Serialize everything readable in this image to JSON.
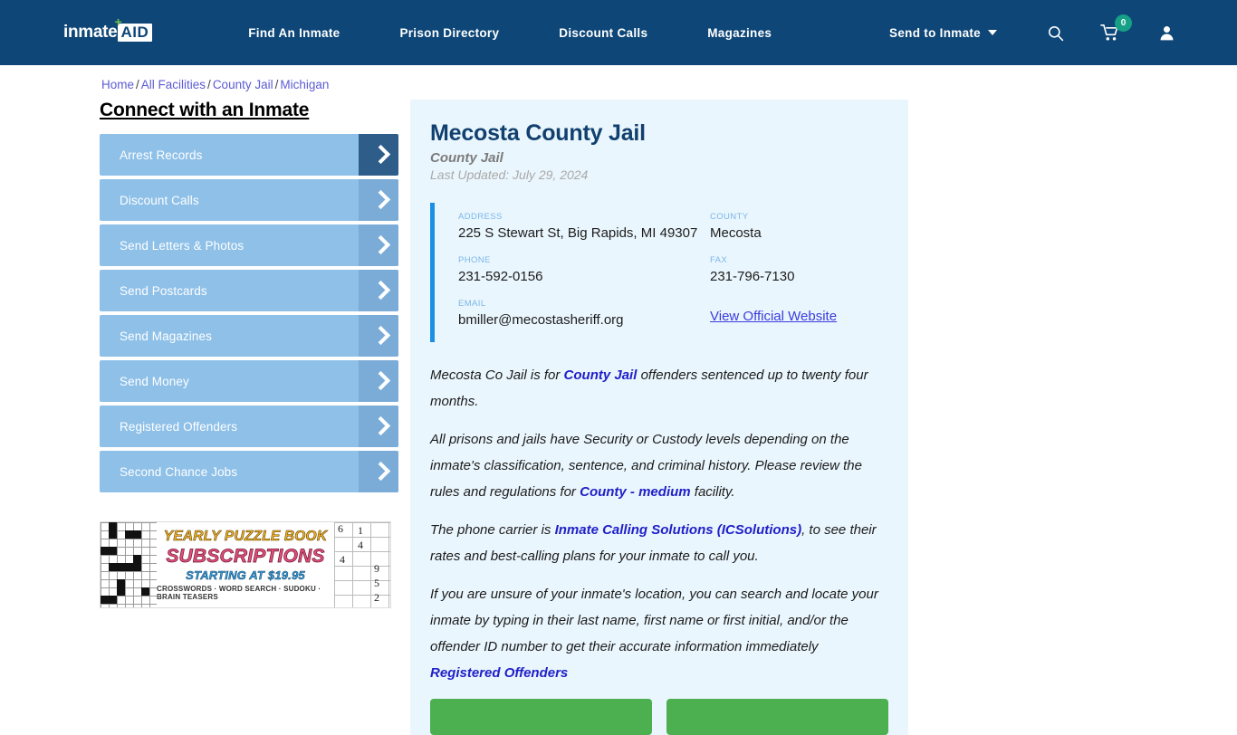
{
  "navbar": {
    "logo": {
      "word": "inmate",
      "badge": "AID",
      "plus": "+"
    },
    "links": [
      {
        "label": "Find An Inmate"
      },
      {
        "label": "Prison Directory"
      },
      {
        "label": "Discount Calls"
      },
      {
        "label": "Magazines"
      }
    ],
    "dropdown": {
      "label": "Send to Inmate"
    },
    "icons": {
      "search": "search-icon",
      "cart": "cart-icon",
      "account": "user-icon"
    },
    "cart_count": "0",
    "bg_color": "#0d4677",
    "badge_color": "#16a085"
  },
  "breadcrumb": {
    "items": [
      "Home",
      "All Facilities",
      "County Jail",
      "Michigan"
    ],
    "separator": "/"
  },
  "sidebar": {
    "title": "Connect with an Inmate",
    "items": [
      {
        "label": "Arrest Records",
        "active": true
      },
      {
        "label": "Discount Calls",
        "active": false
      },
      {
        "label": "Send Letters & Photos",
        "active": false
      },
      {
        "label": "Send Postcards",
        "active": false
      },
      {
        "label": "Send Magazines",
        "active": false
      },
      {
        "label": "Send Money",
        "active": false
      },
      {
        "label": "Registered Offenders",
        "active": false
      },
      {
        "label": "Second Chance Jobs",
        "active": false
      }
    ],
    "button_color": "#8ec0e8",
    "arrow_color": "#7bacd8",
    "arrow_active_color": "#2e5d8a"
  },
  "ad": {
    "line1": "YEARLY PUZZLE BOOK",
    "line2": "SUBSCRIPTIONS",
    "line3": "STARTING AT $19.95",
    "line4": "CROSSWORDS · WORD SEARCH · SUDOKU · BRAIN TEASERS",
    "sudoku_numbers": [
      "6",
      "1",
      "4",
      "4",
      "9",
      "5",
      "2"
    ]
  },
  "facility": {
    "title": "Mecosta County Jail",
    "subtitle": "County Jail",
    "last_updated": "Last Updated: July 29, 2024",
    "info": {
      "address_label": "ADDRESS",
      "address_value": "225 S Stewart St, Big Rapids, MI 49307",
      "county_label": "COUNTY",
      "county_value": "Mecosta",
      "phone_label": "PHONE",
      "phone_value": "231-592-0156",
      "fax_label": "FAX",
      "fax_value": "231-796-7130",
      "email_label": "EMAIL",
      "email_value": "bmiller@mecostasheriff.org",
      "website_link": "View Official Website"
    },
    "paragraphs": {
      "p1_a": "Mecosta Co Jail is for ",
      "p1_link": "County Jail",
      "p1_b": " offenders sentenced up to twenty four months.",
      "p2_a": "All prisons and jails have Security or Custody levels depending on the inmate's classification, sentence, and criminal history. Please review the rules and regulations for ",
      "p2_link": "County - medium",
      "p2_b": " facility.",
      "p3_a": "The phone carrier is ",
      "p3_link": "Inmate Calling Solutions (ICSolutions)",
      "p3_b": ", to see their rates and best-calling plans for your inmate to call you.",
      "p4_a": "If you are unsure of your inmate's location, you can search and locate your inmate by typing in their last name, first name or first initial, and/or the offender ID number to get their accurate information immediately",
      "p4_link": "Registered Offenders"
    },
    "cta": [
      {
        "label": ""
      },
      {
        "label": ""
      }
    ],
    "card_bg": "#eaf6fd",
    "accent_color": "#1a8fe3",
    "title_color": "#11406f",
    "cta_color": "#4caf50"
  }
}
